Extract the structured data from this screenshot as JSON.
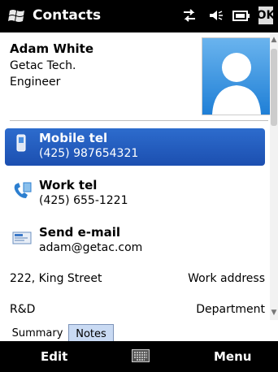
{
  "title_bar": {
    "title": "Contacts",
    "icons": [
      "windows-flag-icon",
      "connectivity-icon",
      "volume-muted-icon",
      "battery-icon"
    ],
    "ok_label": "OK"
  },
  "contact": {
    "name": "Adam White",
    "company": "Getac Tech.",
    "job_title": "Engineer"
  },
  "actions": [
    {
      "label": "Mobile tel",
      "value": "(425) 987654321",
      "icon": "mobile-phone-icon",
      "selected": true
    },
    {
      "label": "Work tel",
      "value": "(425) 655-1221",
      "icon": "work-phone-icon",
      "selected": false
    },
    {
      "label": "Send e-mail",
      "value": "adam@getac.com",
      "icon": "email-icon",
      "selected": false
    }
  ],
  "details": [
    {
      "value": "222, King Street",
      "field": "Work address"
    },
    {
      "value": "R&D",
      "field": "Department"
    }
  ],
  "tabs": [
    "Summary",
    "Notes"
  ],
  "active_tab": "Notes",
  "softkeys": {
    "left": "Edit",
    "center_icon": "keyboard-icon",
    "right": "Menu"
  },
  "colors": {
    "selection": "#1f55b8",
    "bar": "#000000",
    "tab_active": "#c9daf3"
  }
}
